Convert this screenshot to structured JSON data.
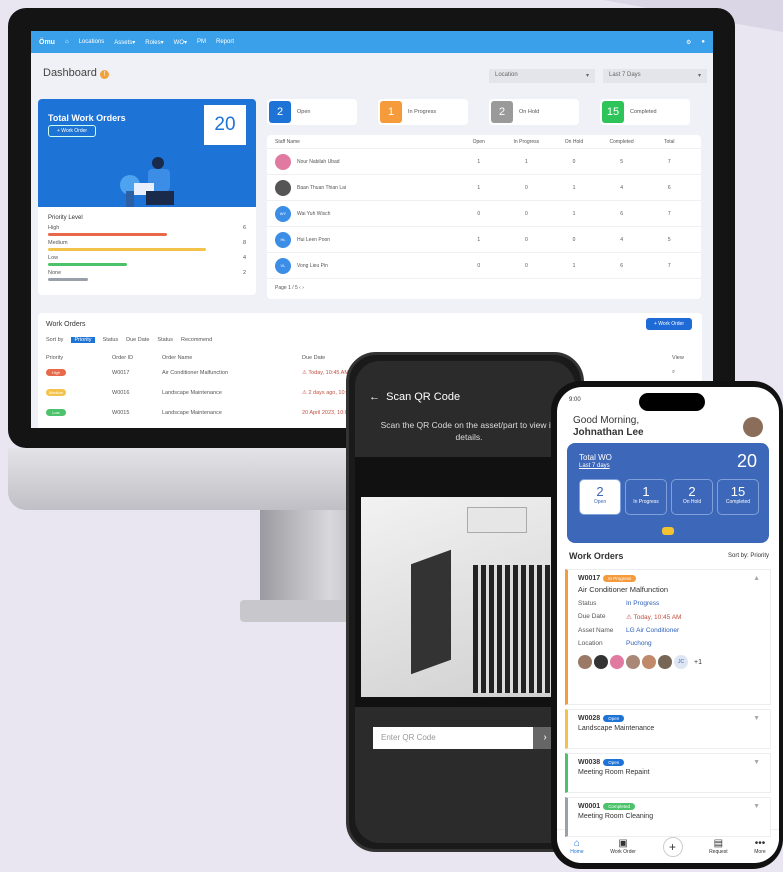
{
  "nav": {
    "logo": "Ömu",
    "items": [
      "Locations",
      "Assets▾",
      "Roles▾",
      "WO▾",
      "PM",
      "Report"
    ]
  },
  "dashboard": {
    "title": "Dashboard",
    "location": "Location",
    "period": "Last 7 Days"
  },
  "total": {
    "title": "Total Work Orders",
    "button": "+ Work Order",
    "count": "20"
  },
  "priority": {
    "title": "Priority Level",
    "items": [
      {
        "label": "High",
        "count": "6",
        "color": "#e8684a",
        "pct": 0.6
      },
      {
        "label": "Medium",
        "count": "8",
        "color": "#f2c24a",
        "pct": 0.8
      },
      {
        "label": "Low",
        "count": "4",
        "color": "#4cc36a",
        "pct": 0.4
      },
      {
        "label": "None",
        "count": "2",
        "color": "#9aa0aa",
        "pct": 0.2
      }
    ]
  },
  "stats": [
    {
      "n": "2",
      "label": "Open",
      "color": "#1e73d6"
    },
    {
      "n": "1",
      "label": "In Progress",
      "color": "#f59b3b"
    },
    {
      "n": "2",
      "label": "On Hold",
      "color": "#9a9a9a"
    },
    {
      "n": "15",
      "label": "Completed",
      "color": "#2ec45a"
    }
  ],
  "staff": {
    "headers": [
      "Staff Name",
      "Open",
      "In Progress",
      "On Hold",
      "Completed",
      "Total"
    ],
    "rows": [
      {
        "av": "",
        "name": "Nour Nabilah Ubad",
        "vals": [
          "1",
          "1",
          "0",
          "5",
          "7"
        ]
      },
      {
        "av": "",
        "name": "Baan Thuan Thian Lai",
        "vals": [
          "1",
          "0",
          "1",
          "4",
          "6"
        ]
      },
      {
        "av": "WY",
        "name": "Wai Yuh Wisch",
        "vals": [
          "0",
          "0",
          "1",
          "6",
          "7"
        ]
      },
      {
        "av": "HL",
        "name": "Hui Leen Poon",
        "vals": [
          "1",
          "0",
          "0",
          "4",
          "5"
        ]
      },
      {
        "av": "VL",
        "name": "Vong Lieu Pin",
        "vals": [
          "0",
          "0",
          "1",
          "6",
          "7"
        ]
      }
    ],
    "pager": "Page 1 / 5"
  },
  "workorders": {
    "title": "Work Orders",
    "new": "+ Work Order",
    "filters": [
      "Sort by",
      "Priority",
      "Status",
      "Due Date",
      "Status",
      "Recommend"
    ],
    "headers": [
      "Priority",
      "Order ID",
      "Order Name",
      "Due Date",
      "View"
    ],
    "rows": [
      {
        "p": "High",
        "pc": "#e8684a",
        "id": "W0017",
        "name": "Air Conditioner Malfunction",
        "due": "⚠ Today, 10:45 AM"
      },
      {
        "p": "Medium",
        "pc": "#f2c24a",
        "id": "W0016",
        "name": "Landscape Maintenance",
        "due": "⚠ 2 days ago, 10:00 AM"
      },
      {
        "p": "Low",
        "pc": "#4cc36a",
        "id": "W0015",
        "name": "Landscape Maintenance",
        "due": "20 April 2023, 10:00 AM"
      }
    ]
  },
  "scan": {
    "title": "Scan QR Code",
    "desc": "Scan the QR Code on the asset/part to view its details.",
    "placeholder": "Enter QR Code"
  },
  "mobile": {
    "time": "9:00",
    "greeting": "Good Morning,",
    "user": "Johnathan Lee",
    "total_label": "Total WO",
    "total_sub": "Last 7 days",
    "total": "20",
    "stats": [
      {
        "n": "2",
        "l": "Open"
      },
      {
        "n": "1",
        "l": "In Progress"
      },
      {
        "n": "2",
        "l": "On Hold"
      },
      {
        "n": "15",
        "l": "Completed"
      }
    ],
    "wo_title": "Work Orders",
    "sort": "Sort by: Priority",
    "first": {
      "id": "W0017",
      "badge": "In Progress",
      "name": "Air Conditioner Malfunction",
      "fields": [
        {
          "k": "Status",
          "v": "In Progress"
        },
        {
          "k": "Due Date",
          "v": "⚠ Today, 10:45 AM"
        },
        {
          "k": "Asset Name",
          "v": "LG Air Conditioner"
        },
        {
          "k": "Location",
          "v": "Puchong"
        }
      ],
      "initials": "JC",
      "extra": "+1"
    },
    "others": [
      {
        "id": "W0028",
        "badge": "Open",
        "bc": "#1e73d6",
        "name": "Landscape Maintenance",
        "lc": "#f2c24a"
      },
      {
        "id": "W0038",
        "badge": "Open",
        "bc": "#1e73d6",
        "name": "Meeting Room Repaint",
        "lc": "#4cc36a"
      },
      {
        "id": "W0001",
        "badge": "Completed",
        "bc": "#4cc36a",
        "name": "Meeting Room Cleaning",
        "lc": "#9aa0aa"
      }
    ],
    "tabs": [
      "Home",
      "Work Order",
      "",
      "Request",
      "More"
    ]
  }
}
